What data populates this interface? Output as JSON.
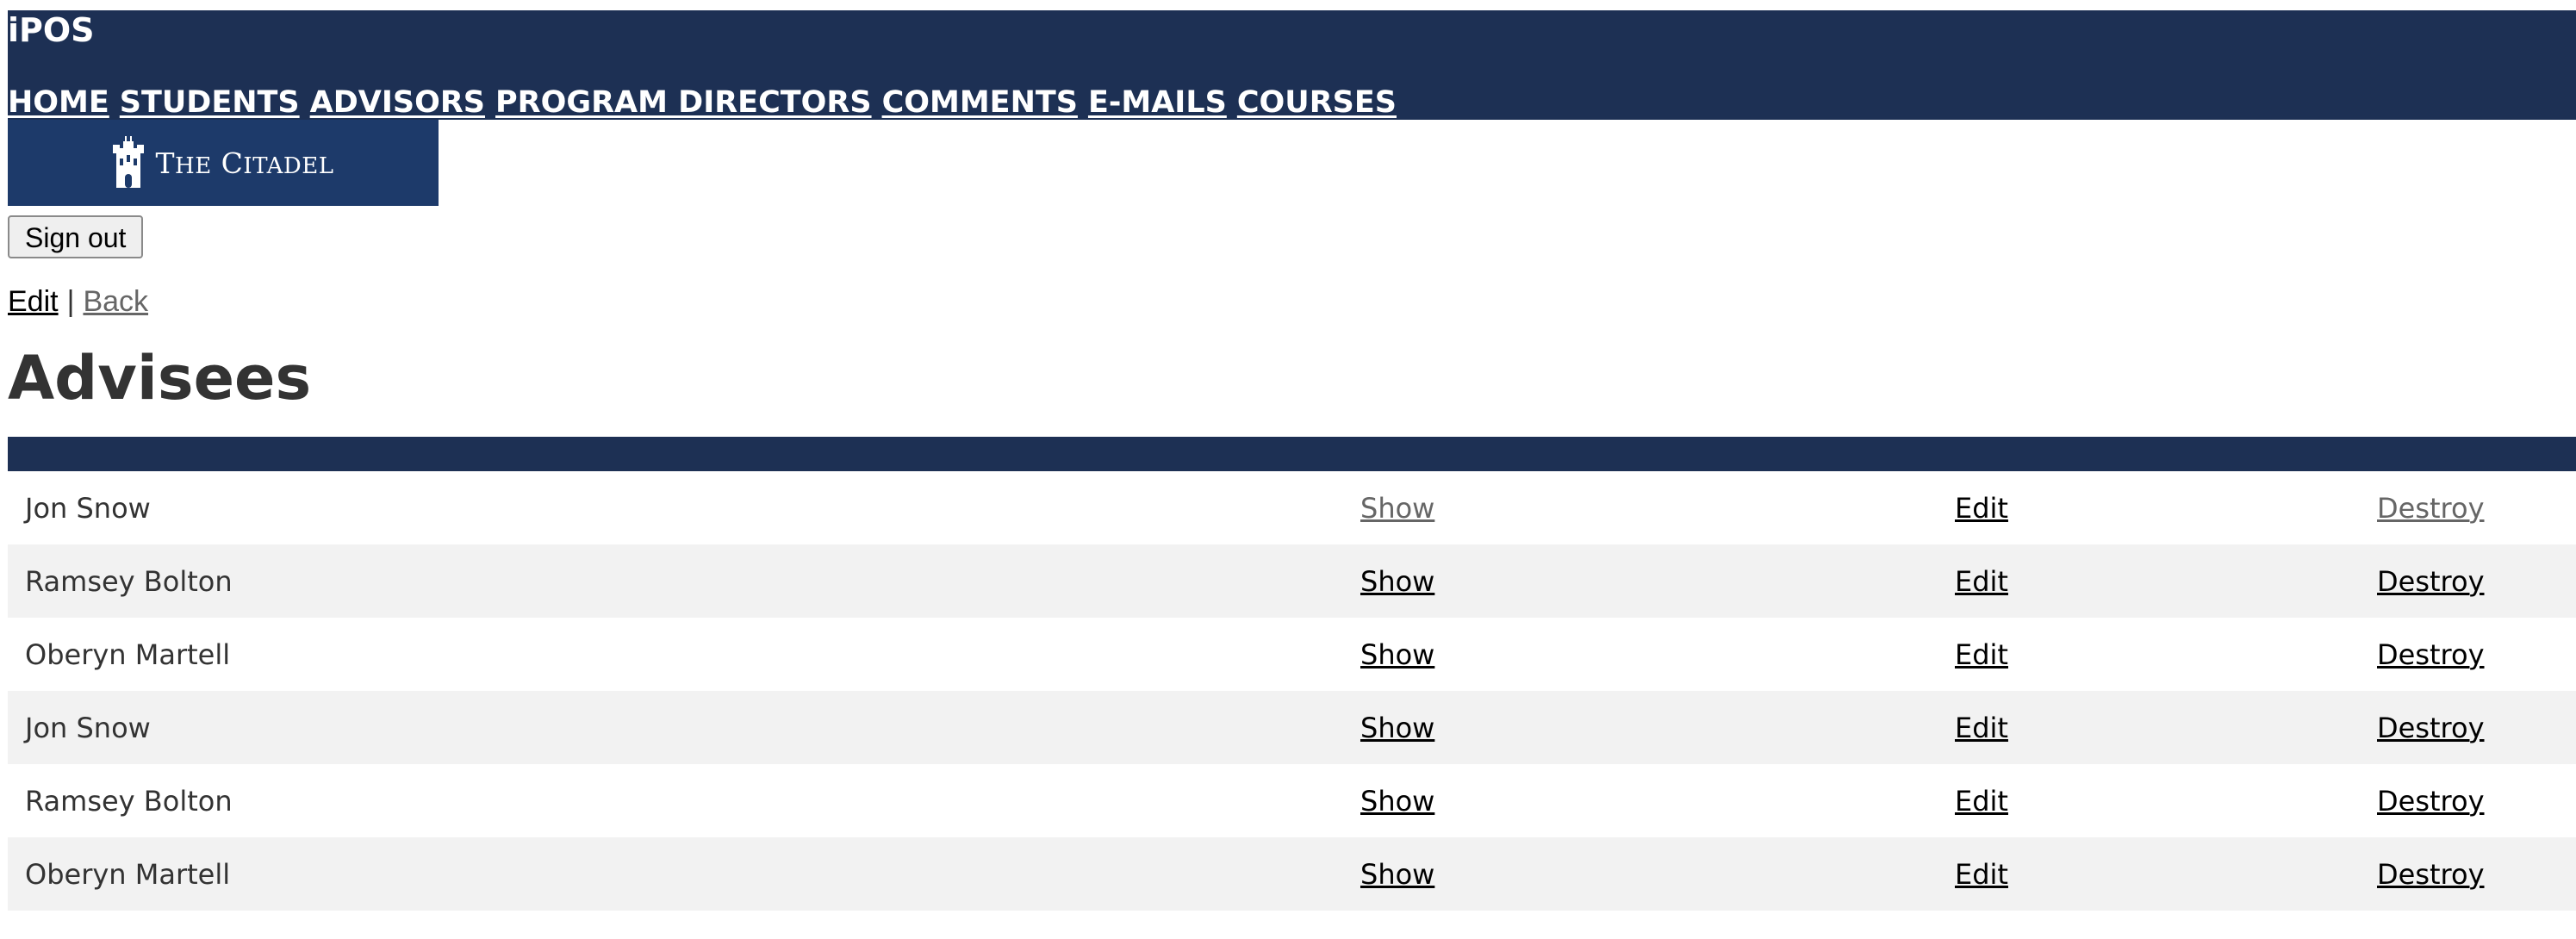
{
  "header": {
    "app_title": "iPOS",
    "nav": [
      "HOME",
      "STUDENTS",
      "ADVISORS",
      "PROGRAM DIRECTORS",
      "COMMENTS",
      "E-MAILS",
      "COURSES"
    ]
  },
  "logo": {
    "text_prefix": "T",
    "text_small": "HE",
    "text_main_c": "C",
    "text_small2": "ITADEL"
  },
  "signout_label": "Sign out",
  "actions": {
    "edit": "Edit",
    "separator": "|",
    "back": "Back"
  },
  "page_title": "Advisees",
  "advisees": [
    {
      "name": "Jon Snow",
      "show": "Show",
      "edit": "Edit",
      "destroy": "Destroy"
    },
    {
      "name": "Ramsey Bolton",
      "show": "Show",
      "edit": "Edit",
      "destroy": "Destroy"
    },
    {
      "name": "Oberyn Martell",
      "show": "Show",
      "edit": "Edit",
      "destroy": "Destroy"
    },
    {
      "name": "Jon Snow",
      "show": "Show",
      "edit": "Edit",
      "destroy": "Destroy"
    },
    {
      "name": "Ramsey Bolton",
      "show": "Show",
      "edit": "Edit",
      "destroy": "Destroy"
    },
    {
      "name": "Oberyn Martell",
      "show": "Show",
      "edit": "Edit",
      "destroy": "Destroy"
    }
  ],
  "colors": {
    "header_bg": "#1d3054",
    "logo_bg": "#1d3a6a",
    "row_alt_bg": "#f2f2f2"
  },
  "icons": {
    "logo": "citadel-castle-icon"
  }
}
